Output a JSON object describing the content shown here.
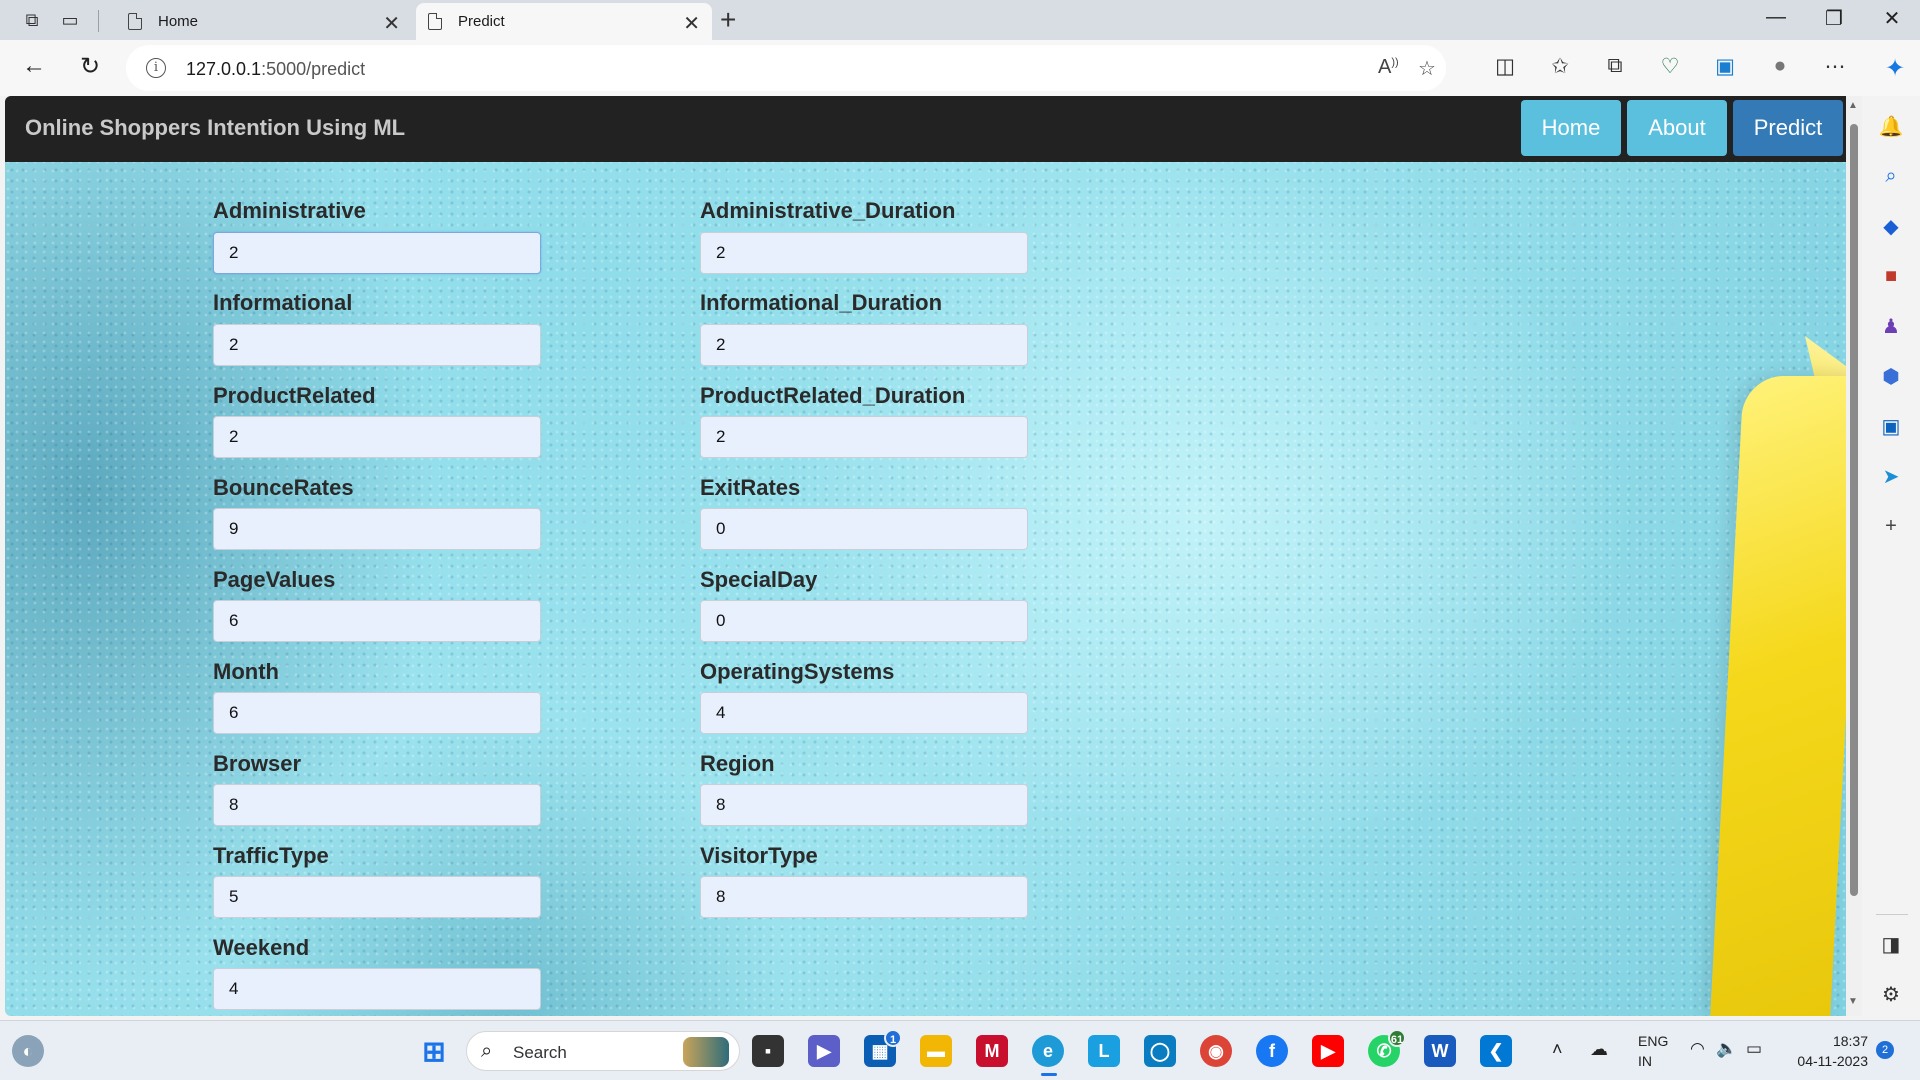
{
  "browser": {
    "tabs": [
      {
        "title": "Home"
      },
      {
        "title": "Predict"
      }
    ],
    "url_host": "127.0.0.1",
    "url_path": ":5000/predict"
  },
  "site": {
    "brand": "Online Shoppers Intention Using ML",
    "nav": {
      "home": "Home",
      "about": "About",
      "predict": "Predict"
    }
  },
  "form": {
    "left": [
      {
        "label": "Administrative",
        "value": "2"
      },
      {
        "label": "Informational",
        "value": "2"
      },
      {
        "label": "ProductRelated",
        "value": "2"
      },
      {
        "label": "BounceRates",
        "value": "9"
      },
      {
        "label": "PageValues",
        "value": "6"
      },
      {
        "label": "Month",
        "value": "6"
      },
      {
        "label": "Browser",
        "value": "8"
      },
      {
        "label": "TrafficType",
        "value": "5"
      },
      {
        "label": "Weekend",
        "value": "4"
      }
    ],
    "right": [
      {
        "label": "Administrative_Duration",
        "value": "2"
      },
      {
        "label": "Informational_Duration",
        "value": "2"
      },
      {
        "label": "ProductRelated_Duration",
        "value": "2"
      },
      {
        "label": "ExitRates",
        "value": "0"
      },
      {
        "label": "SpecialDay",
        "value": "0"
      },
      {
        "label": "OperatingSystems",
        "value": "4"
      },
      {
        "label": "Region",
        "value": "8"
      },
      {
        "label": "VisitorType",
        "value": "8"
      }
    ]
  },
  "taskbar": {
    "search_label": "Search",
    "badges": {
      "store": "1",
      "whatsapp": "61"
    },
    "lang": "ENG",
    "region": "IN",
    "time": "18:37",
    "date": "04-11-2023",
    "notifications": "2"
  },
  "colors": {
    "nav_info": "#5bc0de",
    "nav_primary": "#337ab7",
    "navbar_bg": "#222222",
    "input_bg": "#e8f0fe"
  }
}
